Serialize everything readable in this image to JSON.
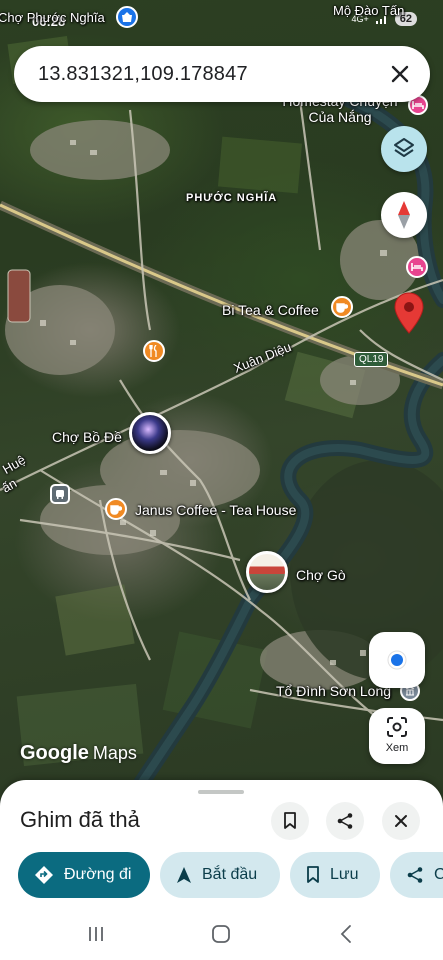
{
  "status_bar": {
    "time": "06:28",
    "network": "4G+",
    "battery": "62"
  },
  "search": {
    "query": "13.831321,109.178847"
  },
  "map_labels": {
    "cho_phuoc_nghia": "Chợ Phước Nghĩa",
    "mo_dao_tan": "Mộ Đào Tấn",
    "homestay": "Homestay Chuyện Của Nắng",
    "phuoc_nghia": "PHƯỚC NGHĨA",
    "bi_tea": "Bi Tea & Coffee",
    "xuan_dieu": "Xuân Diệu",
    "ql19": "QL19",
    "cho_bo_de": "Chợ Bồ Đề",
    "hue": "Huệ",
    "tan": "ấn",
    "janus": "Janus Coffee - Tea House",
    "cho_go": "Chợ Gò",
    "to_dinh": "Tổ Đình Sơn Long"
  },
  "map_controls": {
    "lens_label": "Xem",
    "logo_google": "Google",
    "logo_maps": "Maps"
  },
  "sheet": {
    "title": "Ghim đã thả",
    "chips": [
      {
        "label": "Đường đi",
        "icon": "directions-icon"
      },
      {
        "label": "Bắt đầu",
        "icon": "navigation-arrow-icon"
      },
      {
        "label": "Lưu",
        "icon": "bookmark-icon"
      },
      {
        "label": "C",
        "icon": "share-icon"
      }
    ]
  },
  "colors": {
    "primary_chip": "#0b6b80",
    "secondary_chip": "#d3e8ee",
    "pin_red": "#e53935",
    "poi_orange": "#f08a24",
    "poi_pink": "#e8448f",
    "location_blue": "#1a73e8"
  }
}
